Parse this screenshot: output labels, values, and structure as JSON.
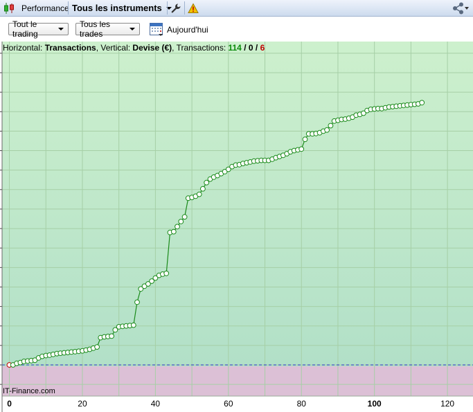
{
  "toolbar": {
    "performance_label": "Performance",
    "instruments_label": "Tous les instruments"
  },
  "controls": {
    "trading_select": "Tout le trading",
    "trades_select": "Tous les trades",
    "date_label": "Aujourd'hui"
  },
  "info": {
    "horizontal_prefix": "Horizontal: ",
    "horizontal_value": "Transactions",
    "vertical_prefix": ", Vertical: ",
    "vertical_value": "Devise (€)",
    "transactions_prefix": ", Transactions: ",
    "total": "114",
    "sep1": " / ",
    "neutral": "0",
    "sep2": " / ",
    "losing": "6"
  },
  "watermark": "IT-Finance.com",
  "colors": {
    "positive_bg_top": "#cdf0cd",
    "positive_bg_bottom": "#b2e0c8",
    "negative_bg": "#dcc0d6",
    "line": "#1a8a1a",
    "zero_line": "#3030c8",
    "winning": "#0a8a0a",
    "losing": "#c00000"
  },
  "icons": [
    "candlestick-icon",
    "wrench-icon",
    "warning-icon",
    "share-icon",
    "calendar-icon"
  ],
  "chart_data": {
    "type": "line",
    "xlabel": "",
    "ylabel": "",
    "xlim": [
      -2,
      127
    ],
    "x_ticks": [
      0,
      20,
      40,
      60,
      80,
      100,
      120
    ],
    "x_tick_labels": [
      "0",
      "20",
      "40",
      "60",
      "80",
      "100",
      "120"
    ],
    "ylim": [
      -8,
      83
    ],
    "y_ticks_labeled": false,
    "grid": true,
    "series": [
      {
        "points": [
          [
            0,
            0
          ],
          [
            1,
            0
          ],
          [
            2,
            0.4
          ],
          [
            3,
            0.6
          ],
          [
            4,
            0.9
          ],
          [
            5,
            1
          ],
          [
            6,
            1.1
          ],
          [
            7,
            1.2
          ],
          [
            8,
            1.8
          ],
          [
            9,
            2.2
          ],
          [
            10,
            2.4
          ],
          [
            11,
            2.5
          ],
          [
            12,
            2.7
          ],
          [
            13,
            2.9
          ],
          [
            14,
            3
          ],
          [
            15,
            3.1
          ],
          [
            16,
            3.2
          ],
          [
            17,
            3.3
          ],
          [
            18,
            3.4
          ],
          [
            19,
            3.5
          ],
          [
            20,
            3.6
          ],
          [
            21,
            3.8
          ],
          [
            22,
            4
          ],
          [
            23,
            4.3
          ],
          [
            24,
            4.6
          ],
          [
            25,
            7
          ],
          [
            26,
            7.2
          ],
          [
            27,
            7.3
          ],
          [
            28,
            7.4
          ],
          [
            29,
            9
          ],
          [
            30,
            9.8
          ],
          [
            31,
            9.9
          ],
          [
            32,
            10
          ],
          [
            33,
            10.1
          ],
          [
            34,
            10.2
          ],
          [
            35,
            16.1
          ],
          [
            36,
            19.5
          ],
          [
            37,
            20.2
          ],
          [
            38,
            20.8
          ],
          [
            39,
            21.5
          ],
          [
            40,
            22.3
          ],
          [
            41,
            23
          ],
          [
            42,
            23.3
          ],
          [
            43,
            23.5
          ],
          [
            44,
            34
          ],
          [
            45,
            34.2
          ],
          [
            46,
            35.5
          ],
          [
            47,
            36.8
          ],
          [
            48,
            38
          ],
          [
            49,
            42.8
          ],
          [
            50,
            43
          ],
          [
            51,
            43.3
          ],
          [
            52,
            43.8
          ],
          [
            53,
            45.2
          ],
          [
            54,
            46.8
          ],
          [
            55,
            47.7
          ],
          [
            56,
            48.2
          ],
          [
            57,
            48.6
          ],
          [
            58,
            49.1
          ],
          [
            59,
            49.6
          ],
          [
            60,
            50.2
          ],
          [
            61,
            50.9
          ],
          [
            62,
            51.3
          ],
          [
            63,
            51.4
          ],
          [
            64,
            51.7
          ],
          [
            65,
            51.9
          ],
          [
            66,
            52.1
          ],
          [
            67,
            52.3
          ],
          [
            68,
            52.4
          ],
          [
            69,
            52.5
          ],
          [
            70,
            52.5
          ],
          [
            71,
            52.5
          ],
          [
            72,
            52.8
          ],
          [
            73,
            53.2
          ],
          [
            74,
            53.5
          ],
          [
            75,
            53.8
          ],
          [
            76,
            54.2
          ],
          [
            77,
            54.7
          ],
          [
            78,
            55
          ],
          [
            79,
            55.2
          ],
          [
            80,
            55.4
          ],
          [
            81,
            57.9
          ],
          [
            82,
            59.3
          ],
          [
            83,
            59.3
          ],
          [
            84,
            59.4
          ],
          [
            85,
            59.6
          ],
          [
            86,
            60
          ],
          [
            87,
            60.3
          ],
          [
            88,
            61.4
          ],
          [
            89,
            62.6
          ],
          [
            90,
            62.8
          ],
          [
            91,
            63
          ],
          [
            92,
            63.1
          ],
          [
            93,
            63.3
          ],
          [
            94,
            63.6
          ],
          [
            95,
            64.1
          ],
          [
            96,
            64.3
          ],
          [
            97,
            64.6
          ],
          [
            98,
            65.3
          ],
          [
            99,
            65.6
          ],
          [
            100,
            65.7
          ],
          [
            101,
            65.8
          ],
          [
            102,
            65.8
          ],
          [
            103,
            66
          ],
          [
            104,
            66.2
          ],
          [
            105,
            66.3
          ],
          [
            106,
            66.4
          ],
          [
            107,
            66.5
          ],
          [
            108,
            66.6
          ],
          [
            109,
            66.7
          ],
          [
            110,
            66.8
          ],
          [
            111,
            66.9
          ],
          [
            112,
            67
          ],
          [
            113,
            67.3
          ]
        ]
      }
    ]
  }
}
